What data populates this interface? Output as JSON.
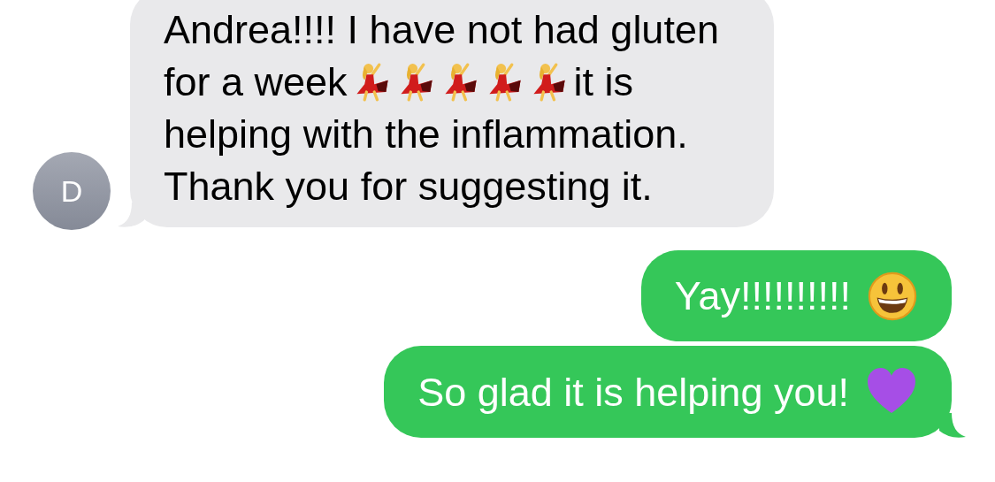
{
  "messages": [
    {
      "kind": "incoming",
      "avatar": "D",
      "tail": true,
      "lines": [
        [
          {
            "kind": "text",
            "text": "Andrea!!!! I have not had gluten"
          }
        ],
        [
          {
            "kind": "text",
            "text": "for a week"
          },
          {
            "kind": "dancer"
          },
          {
            "kind": "dancer"
          },
          {
            "kind": "dancer"
          },
          {
            "kind": "dancer"
          },
          {
            "kind": "dancer"
          },
          {
            "kind": "text",
            "text": "it is"
          }
        ],
        [
          {
            "kind": "text",
            "text": "helping with the inflammation."
          }
        ],
        [
          {
            "kind": "text",
            "text": "Thank you for suggesting it."
          }
        ]
      ]
    },
    {
      "kind": "outgoing",
      "tail": false,
      "lines": [
        [
          {
            "kind": "text",
            "text": "Yay!!!!!!!!!!"
          },
          {
            "kind": "grin"
          }
        ]
      ]
    },
    {
      "kind": "outgoing",
      "tail": true,
      "lines": [
        [
          {
            "kind": "text",
            "text": "So glad it is helping you!"
          },
          {
            "kind": "heart"
          }
        ]
      ]
    }
  ]
}
